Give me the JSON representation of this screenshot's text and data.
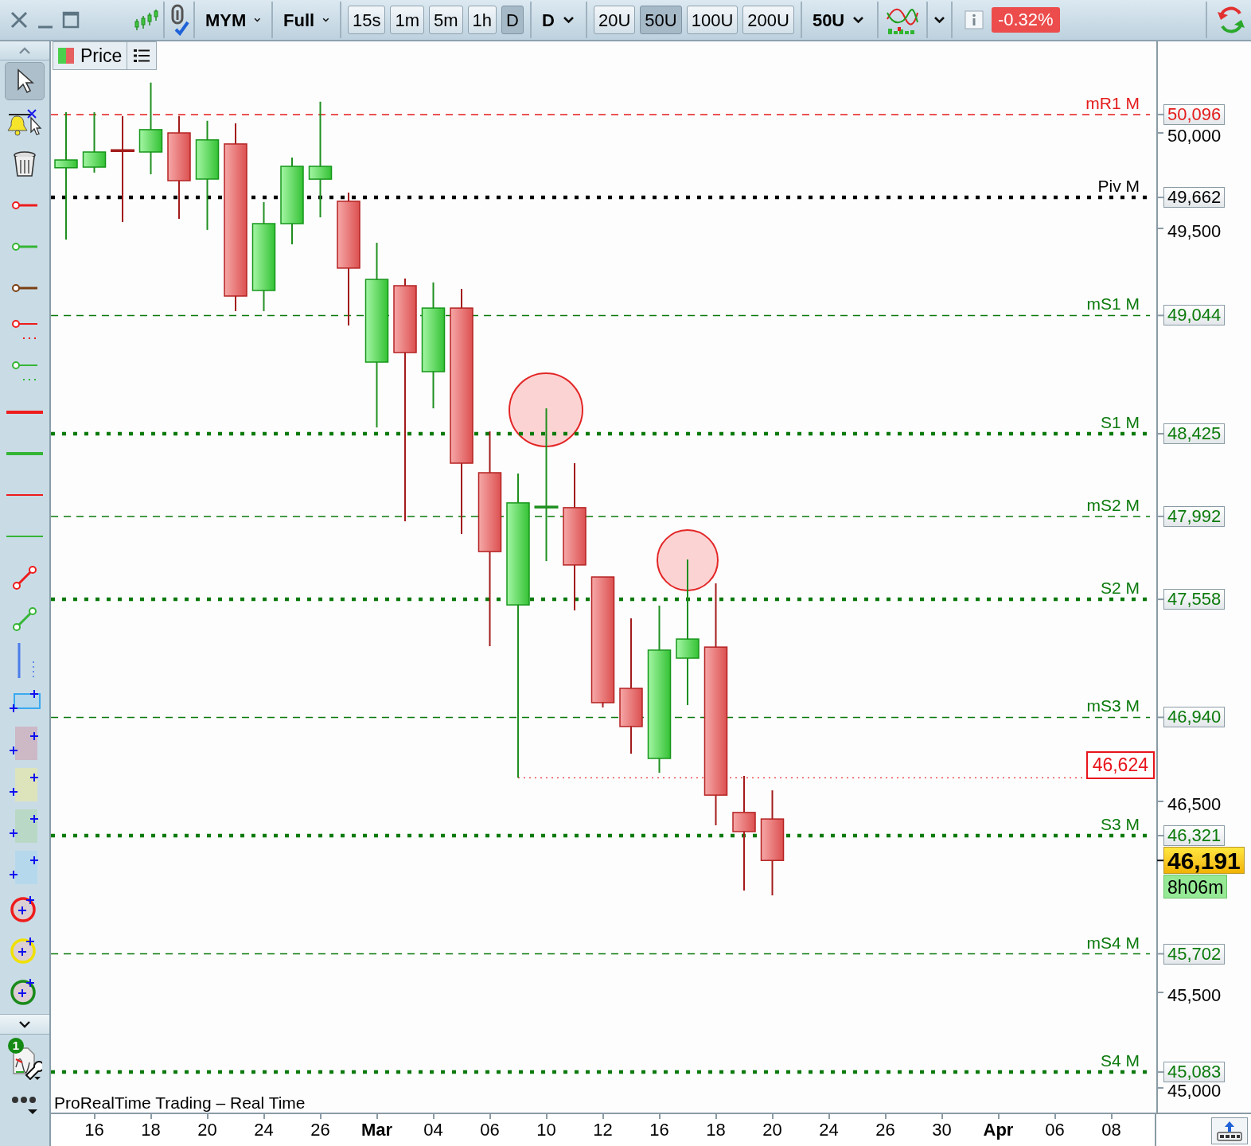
{
  "toolbar": {
    "instrument": "MYM",
    "range": "Full",
    "timeframes": [
      {
        "label": "15s",
        "selected": false
      },
      {
        "label": "1m",
        "selected": false
      },
      {
        "label": "5m",
        "selected": false
      },
      {
        "label": "1h",
        "selected": false
      },
      {
        "label": "D",
        "selected": true
      }
    ],
    "period": "D",
    "units": [
      {
        "label": "20U",
        "selected": false
      },
      {
        "label": "50U",
        "selected": true
      },
      {
        "label": "100U",
        "selected": false
      },
      {
        "label": "200U",
        "selected": false
      }
    ],
    "unit_choice": "50U",
    "change": "-0.32%"
  },
  "drawing_tools": [
    {
      "kind": "pointer",
      "selected": true
    },
    {
      "kind": "alert",
      "selected": false
    },
    {
      "kind": "delete",
      "selected": false
    },
    {
      "kind": "ray",
      "color": "#ee1c1c",
      "selected": false
    },
    {
      "kind": "ray",
      "color": "#35b535",
      "selected": false
    },
    {
      "kind": "ray",
      "color": "#7a3f12",
      "selected": false
    },
    {
      "kind": "ray-dotted",
      "color": "#ee1c1c",
      "selected": false
    },
    {
      "kind": "ray-dotted",
      "color": "#35b535",
      "selected": false
    },
    {
      "kind": "line-thick",
      "color": "#ee1c1c",
      "selected": false
    },
    {
      "kind": "line-thick",
      "color": "#35b535",
      "selected": false
    },
    {
      "kind": "line",
      "color": "#ee1c1c",
      "selected": false
    },
    {
      "kind": "line",
      "color": "#35b535",
      "selected": false
    },
    {
      "kind": "segment",
      "color": "#ee1c1c",
      "selected": false
    },
    {
      "kind": "segment",
      "color": "#35b535",
      "selected": false
    },
    {
      "kind": "vertical",
      "color": "#4a7be8",
      "selected": false
    },
    {
      "kind": "rectangle",
      "color": "#b6d8ea",
      "selected": false
    },
    {
      "kind": "zone",
      "color": "#cdb8c6",
      "selected": false
    },
    {
      "kind": "zone",
      "color": "#dde3bb",
      "selected": false
    },
    {
      "kind": "zone",
      "color": "#b9d9c6",
      "selected": false
    },
    {
      "kind": "zone",
      "color": "#b5d8ec",
      "selected": false
    },
    {
      "kind": "circle",
      "color": "#ee1c1c",
      "selected": false
    },
    {
      "kind": "circle",
      "color": "#f0e000",
      "selected": false
    },
    {
      "kind": "circle",
      "color": "#1a8a1a",
      "selected": false
    }
  ],
  "settings_badge": "1",
  "chart": {
    "tab": "Price",
    "footer": "ProRealTime Trading – Real Time",
    "levels": [
      {
        "label": "mR1 M",
        "value": "50,096",
        "kind": "dashed",
        "color": "#e41b1b"
      },
      {
        "label": "Piv M",
        "value": "49,662",
        "kind": "dotted",
        "color": "#000000"
      },
      {
        "label": "mS1 M",
        "value": "49,044",
        "kind": "dashed",
        "color": "#0b7a0b"
      },
      {
        "label": "S1 M",
        "value": "48,425",
        "kind": "dotted",
        "color": "#0b7a0b"
      },
      {
        "label": "mS2 M",
        "value": "47,992",
        "kind": "dashed",
        "color": "#0b7a0b"
      },
      {
        "label": "S2 M",
        "value": "47,558",
        "kind": "dotted",
        "color": "#0b7a0b"
      },
      {
        "label": "mS3 M",
        "value": "46,940",
        "kind": "dashed",
        "color": "#0b7a0b"
      },
      {
        "label": "S3 M",
        "value": "46,321",
        "kind": "dotted",
        "color": "#0b7a0b"
      },
      {
        "label": "mS4 M",
        "value": "45,702",
        "kind": "dashed",
        "color": "#0b7a0b"
      },
      {
        "label": "S4 M",
        "value": "45,083",
        "kind": "dotted",
        "color": "#0b7a0b"
      }
    ],
    "marker": "46,624",
    "last_price": "46,191",
    "countdown": "8h06m",
    "y_axis": [
      "50,000",
      "49,500",
      "46,500",
      "45,500",
      "45,000"
    ]
  },
  "x_axis": [
    {
      "label": "16",
      "kind": "day"
    },
    {
      "label": "18",
      "kind": "day"
    },
    {
      "label": "20",
      "kind": "day"
    },
    {
      "label": "24",
      "kind": "day"
    },
    {
      "label": "26",
      "kind": "day"
    },
    {
      "label": "Mar",
      "kind": "month"
    },
    {
      "label": "04",
      "kind": "day"
    },
    {
      "label": "06",
      "kind": "day"
    },
    {
      "label": "10",
      "kind": "day"
    },
    {
      "label": "12",
      "kind": "day"
    },
    {
      "label": "16",
      "kind": "day"
    },
    {
      "label": "18",
      "kind": "day"
    },
    {
      "label": "20",
      "kind": "day"
    },
    {
      "label": "24",
      "kind": "day"
    },
    {
      "label": "26",
      "kind": "day"
    },
    {
      "label": "30",
      "kind": "day"
    },
    {
      "label": "Apr",
      "kind": "month"
    },
    {
      "label": "06",
      "kind": "day"
    },
    {
      "label": "08",
      "kind": "day"
    }
  ]
}
